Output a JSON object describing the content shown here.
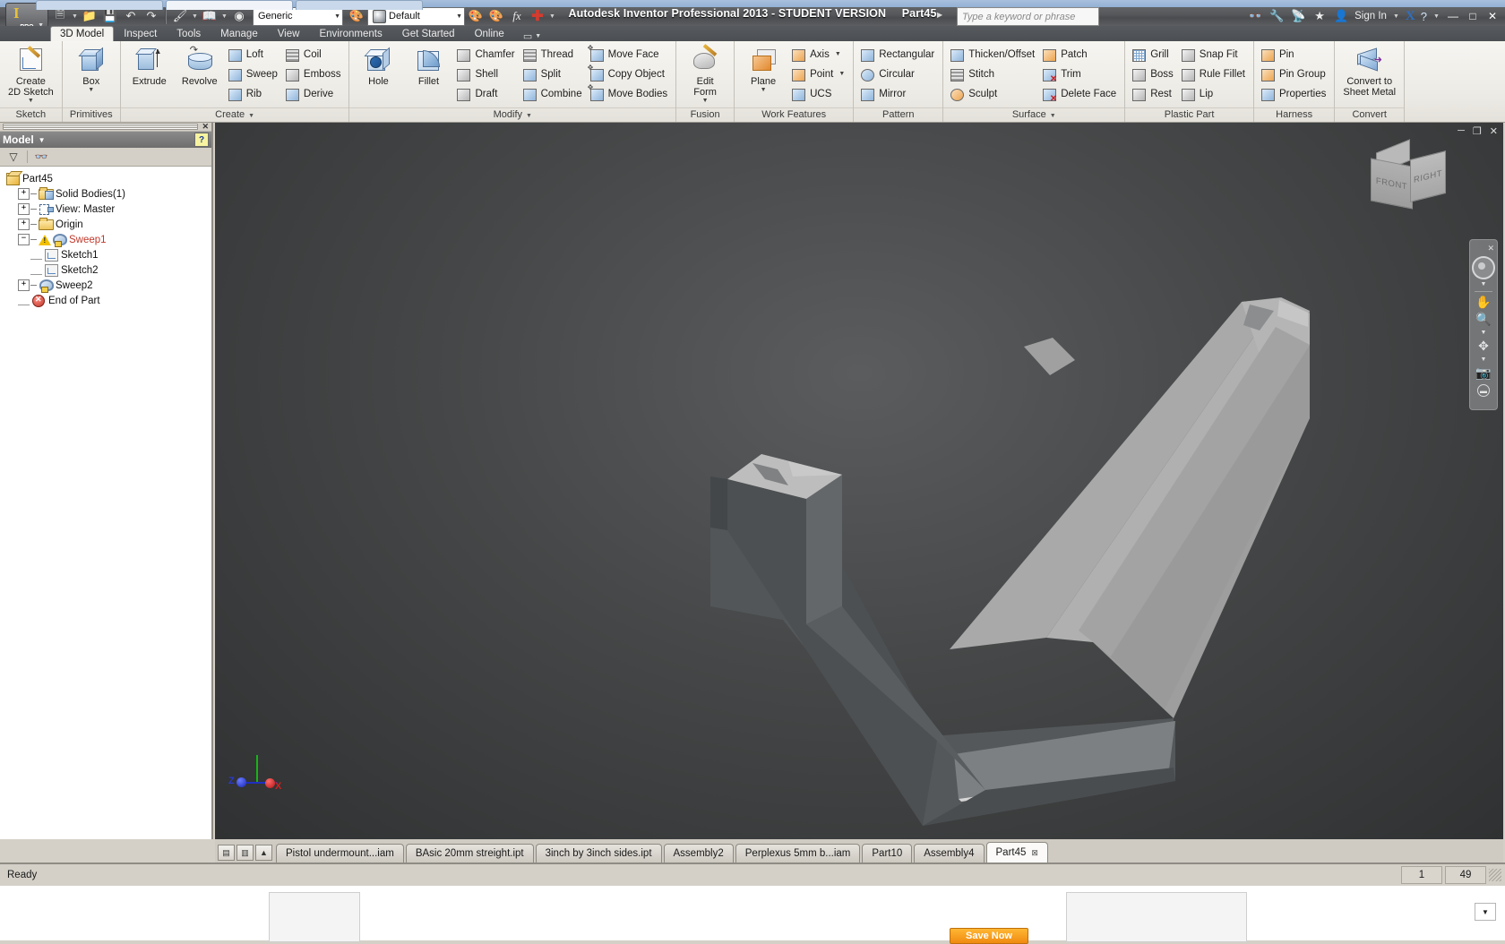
{
  "titlebar": {
    "app_title": "Autodesk Inventor Professional 2013 - STUDENT VERSION",
    "document_name": "Part45",
    "app_button_label": "PRO",
    "app_button_icon": "inventor-logo-icon",
    "quick_access": [
      {
        "name": "new-document",
        "icon": "new-file-icon",
        "has_caret": true
      },
      {
        "name": "open-document",
        "icon": "open-folder-icon",
        "has_caret": false
      },
      {
        "name": "save-document",
        "icon": "floppy-save-icon",
        "has_caret": false
      },
      {
        "name": "undo",
        "icon": "undo-arrow-icon",
        "has_caret": false
      },
      {
        "name": "redo",
        "icon": "redo-arrow-icon",
        "has_caret": false
      },
      {
        "name": "appearance-paint",
        "icon": "paint-bucket-icon",
        "has_caret": true
      },
      {
        "name": "material-select",
        "icon": "material-book-icon",
        "has_caret": true
      },
      {
        "name": "render-globe",
        "icon": "globe-icon",
        "has_caret": false
      }
    ],
    "material_combo": {
      "value": "Generic",
      "name": "material-dropdown"
    },
    "appearance_combo": {
      "value": "Default",
      "name": "appearance-dropdown"
    },
    "right_icons": [
      {
        "name": "adjust-color-icon"
      },
      {
        "name": "clear-color-icon"
      },
      {
        "name": "fx-parameters-icon"
      },
      {
        "name": "add-plus-icon"
      }
    ],
    "search_placeholder": "Type a keyword or phrase",
    "help_icons": [
      {
        "name": "search-binoculars-icon"
      },
      {
        "name": "subscription-wrench-icon"
      },
      {
        "name": "satellite-dish-icon"
      },
      {
        "name": "favorites-star-icon"
      }
    ],
    "sign_in": "Sign In",
    "exchange_label": "X",
    "help_label": "?",
    "window_controls": [
      "minimize",
      "maximize",
      "close"
    ]
  },
  "ribbon": {
    "tabs": [
      {
        "label": "3D Model",
        "active": true
      },
      {
        "label": "Inspect",
        "active": false
      },
      {
        "label": "Tools",
        "active": false
      },
      {
        "label": "Manage",
        "active": false
      },
      {
        "label": "View",
        "active": false
      },
      {
        "label": "Environments",
        "active": false
      },
      {
        "label": "Get Started",
        "active": false
      },
      {
        "label": "Online",
        "active": false
      }
    ],
    "panels": [
      {
        "title": "Sketch",
        "big_buttons": [
          {
            "label_line1": "Create",
            "label_line2": "2D Sketch",
            "icon": "create-sketch-icon",
            "has_caret": true
          }
        ],
        "columns": []
      },
      {
        "title": "Primitives",
        "big_buttons": [
          {
            "label_line1": "Box",
            "label_line2": "",
            "icon": "box-primitive-icon",
            "has_caret": true
          }
        ],
        "columns": []
      },
      {
        "title": "Create",
        "has_title_caret": true,
        "big_buttons": [
          {
            "label_line1": "Extrude",
            "label_line2": "",
            "icon": "extrude-icon",
            "has_caret": false
          },
          {
            "label_line1": "Revolve",
            "label_line2": "",
            "icon": "revolve-icon",
            "has_caret": false
          }
        ],
        "columns": [
          [
            {
              "label": "Loft",
              "icon": "loft-icon"
            },
            {
              "label": "Sweep",
              "icon": "sweep-icon"
            },
            {
              "label": "Rib",
              "icon": "rib-icon"
            }
          ],
          [
            {
              "label": "Coil",
              "icon": "coil-icon"
            },
            {
              "label": "Emboss",
              "icon": "emboss-icon"
            },
            {
              "label": "Derive",
              "icon": "derive-icon"
            }
          ]
        ]
      },
      {
        "title": "Modify",
        "has_title_caret": true,
        "big_buttons": [
          {
            "label_line1": "Hole",
            "label_line2": "",
            "icon": "hole-icon",
            "has_caret": false
          },
          {
            "label_line1": "Fillet",
            "label_line2": "",
            "icon": "fillet-icon",
            "has_caret": false
          }
        ],
        "columns": [
          [
            {
              "label": "Chamfer",
              "icon": "chamfer-icon"
            },
            {
              "label": "Shell",
              "icon": "shell-icon"
            },
            {
              "label": "Draft",
              "icon": "draft-icon"
            }
          ],
          [
            {
              "label": "Thread",
              "icon": "thread-icon"
            },
            {
              "label": "Split",
              "icon": "split-icon"
            },
            {
              "label": "Combine",
              "icon": "combine-icon"
            }
          ],
          [
            {
              "label": "Move Face",
              "icon": "move-face-icon"
            },
            {
              "label": "Copy Object",
              "icon": "copy-object-icon"
            },
            {
              "label": "Move Bodies",
              "icon": "move-bodies-icon"
            }
          ]
        ]
      },
      {
        "title": "Fusion",
        "big_buttons": [
          {
            "label_line1": "Edit",
            "label_line2": "Form",
            "icon": "edit-form-icon",
            "has_caret": true
          }
        ],
        "columns": []
      },
      {
        "title": "Work Features",
        "big_buttons": [
          {
            "label_line1": "Plane",
            "label_line2": "",
            "icon": "work-plane-icon",
            "has_caret": true
          }
        ],
        "columns": [
          [
            {
              "label": "Axis",
              "icon": "work-axis-icon",
              "has_caret": true
            },
            {
              "label": "Point",
              "icon": "work-point-icon",
              "has_caret": true
            },
            {
              "label": "UCS",
              "icon": "ucs-icon"
            }
          ]
        ]
      },
      {
        "title": "Pattern",
        "big_buttons": [],
        "columns": [
          [
            {
              "label": "Rectangular",
              "icon": "rectangular-pattern-icon"
            },
            {
              "label": "Circular",
              "icon": "circular-pattern-icon"
            },
            {
              "label": "Mirror",
              "icon": "mirror-icon"
            }
          ]
        ]
      },
      {
        "title": "Surface",
        "has_title_caret": true,
        "big_buttons": [],
        "columns": [
          [
            {
              "label": "Thicken/Offset",
              "icon": "thicken-offset-icon"
            },
            {
              "label": "Stitch",
              "icon": "stitch-icon"
            },
            {
              "label": "Sculpt",
              "icon": "sculpt-icon"
            }
          ],
          [
            {
              "label": "Patch",
              "icon": "patch-icon"
            },
            {
              "label": "Trim",
              "icon": "trim-scissors-icon"
            },
            {
              "label": "Delete Face",
              "icon": "delete-face-icon"
            }
          ]
        ]
      },
      {
        "title": "Plastic Part",
        "big_buttons": [],
        "columns": [
          [
            {
              "label": "Grill",
              "icon": "grill-icon"
            },
            {
              "label": "Boss",
              "icon": "boss-icon"
            },
            {
              "label": "Rest",
              "icon": "rest-icon"
            }
          ],
          [
            {
              "label": "Snap Fit",
              "icon": "snap-fit-icon"
            },
            {
              "label": "Rule Fillet",
              "icon": "rule-fillet-icon"
            },
            {
              "label": "Lip",
              "icon": "lip-icon"
            }
          ]
        ]
      },
      {
        "title": "Harness",
        "big_buttons": [],
        "columns": [
          [
            {
              "label": "Pin",
              "icon": "pin-icon"
            },
            {
              "label": "Pin Group",
              "icon": "pin-group-icon"
            },
            {
              "label": "Properties",
              "icon": "harness-properties-icon"
            }
          ]
        ]
      },
      {
        "title": "Convert",
        "big_buttons": [
          {
            "label_line1": "Convert to",
            "label_line2": "Sheet Metal",
            "icon": "convert-sheet-metal-icon",
            "has_caret": false
          }
        ],
        "columns": []
      }
    ]
  },
  "browser": {
    "panel_title": "Model",
    "help_glyph": "?",
    "toolbar": [
      {
        "name": "filter-icon",
        "glyph": "▽"
      },
      {
        "name": "find-binoculars-icon",
        "glyph": "&#128083;"
      }
    ],
    "tree": [
      {
        "label": "Part45",
        "icon": "part-icon",
        "indent": 0,
        "expander": "none",
        "state": "normal"
      },
      {
        "label": "Solid Bodies(1)",
        "icon": "solid-bodies-icon",
        "indent": 1,
        "expander": "plus",
        "state": "normal"
      },
      {
        "label": "View: Master",
        "icon": "view-master-icon",
        "indent": 1,
        "expander": "plus",
        "state": "normal"
      },
      {
        "label": "Origin",
        "icon": "folder-icon",
        "indent": 1,
        "expander": "plus",
        "state": "normal"
      },
      {
        "label": "Sweep1",
        "icon": "sweep-feature-icon",
        "indent": 1,
        "expander": "minus",
        "state": "error",
        "warning": true
      },
      {
        "label": "Sketch1",
        "icon": "sketch-icon",
        "indent": 2,
        "expander": "none",
        "state": "normal"
      },
      {
        "label": "Sketch2",
        "icon": "sketch-icon",
        "indent": 2,
        "expander": "none",
        "state": "normal"
      },
      {
        "label": "Sweep2",
        "icon": "sweep-feature-icon",
        "indent": 1,
        "expander": "plus",
        "state": "normal"
      },
      {
        "label": "End of Part",
        "icon": "end-of-part-icon",
        "indent": 1,
        "expander": "none",
        "state": "normal"
      }
    ]
  },
  "viewport": {
    "window_controls": {
      "minimize": "─",
      "restore": "❐",
      "close": "✕"
    },
    "viewcube": {
      "front_label": "FRONT",
      "right_label": "RIGHT"
    },
    "navbar": [
      {
        "name": "navbar-close-icon",
        "glyph": "✕"
      },
      {
        "name": "steering-wheel-icon",
        "glyph": ""
      },
      {
        "name": "pan-hand-icon",
        "glyph": "✋"
      },
      {
        "name": "zoom-magnifier-icon",
        "glyph": "&#128269;"
      },
      {
        "name": "orbit-icon",
        "glyph": "✥"
      },
      {
        "name": "look-at-camera-icon",
        "glyph": "&#128247;"
      },
      {
        "name": "navbar-options-icon",
        "glyph": "▬"
      }
    ],
    "axis_indicator": {
      "x_label": "X",
      "y_label": "",
      "z_label": "Z",
      "x_color": "#cc2222",
      "y_color": "#17b317",
      "z_color": "#2b39c9"
    },
    "model_description": "swept C-channel V-shaped bracket solid"
  },
  "document_tabs": {
    "controls": [
      {
        "name": "tile-windows-button",
        "glyph": "▤"
      },
      {
        "name": "cascade-windows-button",
        "glyph": "▥"
      },
      {
        "name": "tab-scroll-up-button",
        "glyph": "▲"
      }
    ],
    "tabs": [
      {
        "label": "Pistol undermount...iam",
        "active": false,
        "closable": false
      },
      {
        "label": "BAsic 20mm streight.ipt",
        "active": false,
        "closable": false
      },
      {
        "label": "3inch by 3inch sides.ipt",
        "active": false,
        "closable": false
      },
      {
        "label": "Assembly2",
        "active": false,
        "closable": false
      },
      {
        "label": "Perplexus 5mm b...iam",
        "active": false,
        "closable": false
      },
      {
        "label": "Part10",
        "active": false,
        "closable": false
      },
      {
        "label": "Assembly4",
        "active": false,
        "closable": false
      },
      {
        "label": "Part45",
        "active": true,
        "closable": true,
        "close_glyph": "⊠"
      }
    ]
  },
  "statusbar": {
    "message": "Ready",
    "field_1": "1",
    "field_2": "49"
  },
  "taskbar": {
    "save_now_label": "Save Now",
    "dropdown_glyph": "▼"
  },
  "colors": {
    "titlebar_dark": "#55575a",
    "ribbon_bg": "#eceae4",
    "viewport_dark": "#454748",
    "model_light_face": "#a8a8a8",
    "model_dark_face": "#4b4d4f",
    "model_mid_face": "#6e7072",
    "error_text": "#c0392b",
    "accent_orange": "#f08a10",
    "axis_x": "#cc2222",
    "axis_y": "#17b317",
    "axis_z": "#2b39c9"
  }
}
